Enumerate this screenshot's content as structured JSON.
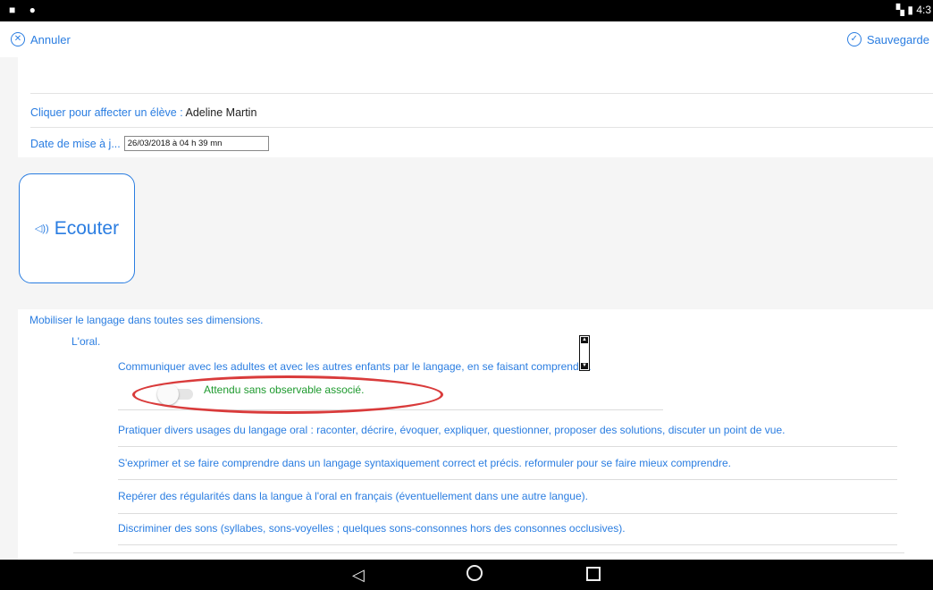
{
  "status": {
    "time": "4:3"
  },
  "toolbar": {
    "cancel_label": "Annuler",
    "save_label": "Sauvegarde"
  },
  "form": {
    "assign_label": "Cliquer pour affecter un élève :",
    "student_name": "Adeline Martin",
    "date_label": "Date de mise à j...",
    "date_value": "26/03/2018 à 04 h 39 mn"
  },
  "listen_button": {
    "label": "Ecouter"
  },
  "domain": {
    "title": "Mobiliser le langage dans toutes ses dimensions.",
    "sub": "L'oral.",
    "items": [
      "Communiquer avec les adultes et avec les autres enfants par le langage, en se faisant comprendre.",
      "Pratiquer divers usages du langage oral : raconter, décrire, évoquer, expliquer, questionner, proposer des solutions, discuter un point de vue.",
      "S'exprimer et se faire comprendre dans un langage syntaxiquement correct et précis. reformuler pour se faire mieux comprendre.",
      "Repérer des régularités dans la langue à l'oral en français (éventuellement dans une autre langue).",
      "Discriminer des sons (syllabes, sons-voyelles ; quelques sons-consonnes hors des consonnes occlusives)."
    ],
    "observable_label": "Attendu sans observable associé.",
    "toggle_on": false
  },
  "colors": {
    "accent": "#2a7de1",
    "green": "#1e9a2e",
    "annotation": "#d93b3b"
  }
}
